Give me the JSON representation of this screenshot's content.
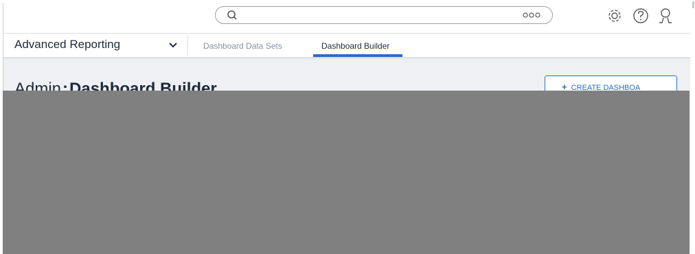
{
  "topbar": {
    "search": {
      "placeholder": "",
      "value": "",
      "search_icon": "search-icon",
      "more_icon": "more-icon"
    },
    "icons": [
      "gear-icon",
      "help-icon",
      "user-icon"
    ]
  },
  "navbar": {
    "app_title": "Advanced Reporting",
    "app_menu_icon": "chevron-down-icon",
    "tabs": [
      {
        "label": "Dashboard Data Sets",
        "active": false
      },
      {
        "label": "Dashboard Builder",
        "active": true
      }
    ]
  },
  "page": {
    "breadcrumb_prefix": "Admin",
    "title": "Dashboard Builder",
    "create_button": {
      "label": "CREATE DASHBOA",
      "icon": "plus-icon"
    }
  },
  "colors": {
    "accent": "#2b6cc4",
    "text_dark": "#1e2a3a",
    "overlay": "#808080",
    "background": "#eef0f3"
  }
}
